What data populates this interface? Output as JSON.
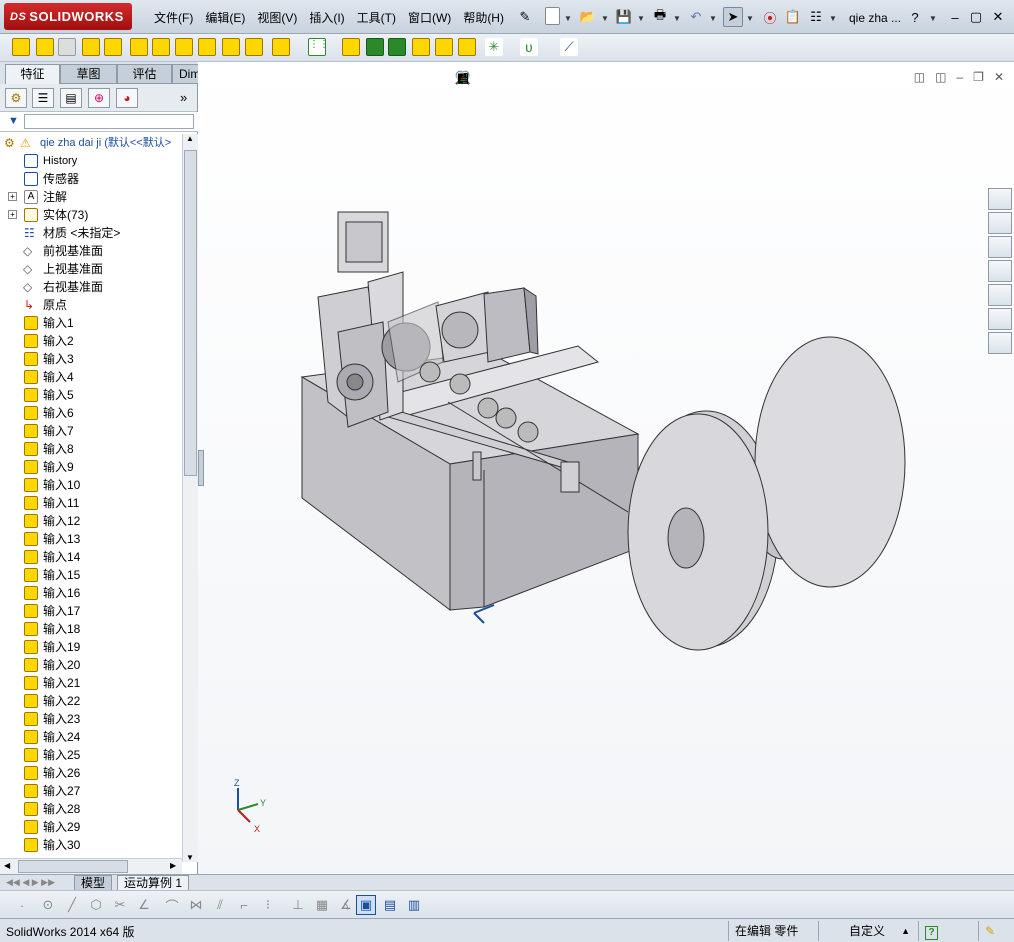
{
  "app": {
    "logo_prefix": "DS",
    "logo_text": "SOLIDWORKS",
    "doc_title": "qie zha ..."
  },
  "menu": [
    "文件(F)",
    "编辑(E)",
    "视图(V)",
    "插入(I)",
    "工具(T)",
    "窗口(W)",
    "帮助(H)"
  ],
  "tabs": [
    "特征",
    "草图",
    "评估",
    "DimXpert"
  ],
  "tree": {
    "root": "qie zha dai ji  (默认<<默认>",
    "items": [
      {
        "label": "History",
        "expand": false
      },
      {
        "label": "传感器",
        "expand": false
      },
      {
        "label": "注解",
        "expand": true
      },
      {
        "label": "实体(73)",
        "expand": true
      },
      {
        "label": "材质 <未指定>",
        "expand": false
      },
      {
        "label": "前视基准面",
        "expand": false
      },
      {
        "label": "上视基准面",
        "expand": false
      },
      {
        "label": "右视基准面",
        "expand": false
      },
      {
        "label": "原点",
        "expand": false
      }
    ],
    "inputs": [
      "输入1",
      "输入2",
      "输入3",
      "输入4",
      "输入5",
      "输入6",
      "输入7",
      "输入8",
      "输入9",
      "输入10",
      "输入11",
      "输入12",
      "输入13",
      "输入14",
      "输入15",
      "输入16",
      "输入17",
      "输入18",
      "输入19",
      "输入20",
      "输入21",
      "输入22",
      "输入23",
      "输入24",
      "输入25",
      "输入26",
      "输入27",
      "输入28",
      "输入29",
      "输入30"
    ]
  },
  "bottom_tabs": [
    "模型",
    "运动算例 1"
  ],
  "status": {
    "app_version": "SolidWorks 2014 x64 版",
    "mode": "在编辑 零件",
    "units": "自定义",
    "help": "?"
  },
  "triad": {
    "x": "X",
    "y": "Y",
    "z": "Z"
  },
  "colors": {
    "accent": "#1a4fa0",
    "titlebar": "#c9d3de",
    "logo": "#c01e1e",
    "feature_icon": "#ffd700"
  }
}
